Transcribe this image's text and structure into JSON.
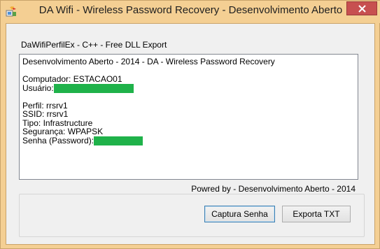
{
  "window": {
    "title": "DA Wifi - Wireless Password Recovery - Desenvolvimento Aberto",
    "icon": "app-wifi-icon",
    "close_icon": "close-icon",
    "accent_color": "#f4cf93",
    "close_color": "#c75050"
  },
  "header": {
    "label": "DaWifiPerfilEx - C++ - Free DLL Export"
  },
  "output": {
    "line_title": "Desenvolvimento Aberto - 2014 - DA - Wireless Password Recovery",
    "computer": "Computador: ESTACAO01",
    "user_label": "Usuário:",
    "profile": "Perfil: rrsrv1",
    "ssid": "SSID: rrsrv1",
    "type": "Tipo: Infrastructure",
    "security": "Segurança: WPAPSK",
    "password_label": "Senha (Password):",
    "redaction_color": "#1fb24a"
  },
  "footer": {
    "credit": "Powred by - Desenvolvimento Aberto - 2014",
    "capture_button": "Captura Senha",
    "export_button": "Exporta TXT"
  }
}
